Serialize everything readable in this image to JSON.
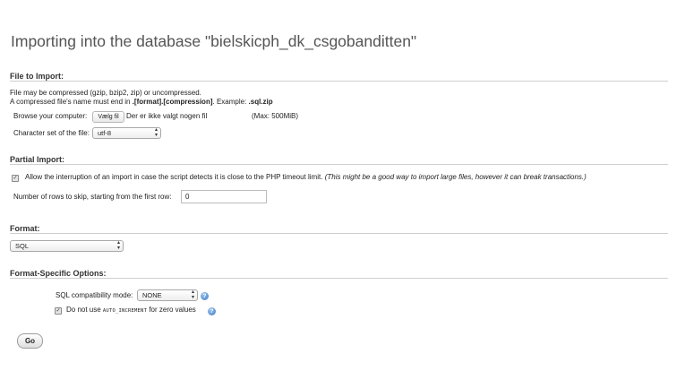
{
  "page": {
    "title": "Importing into the database \"bielskicph_dk_csgobanditten\""
  },
  "file_to_import": {
    "heading": "File to Import:",
    "compress_note": "File may be compressed (gzip, bzip2, zip) or uncompressed.",
    "name_note_prefix": "A compressed file's name must end in ",
    "name_note_format": ".[format].[compression]",
    "name_note_example_label": ". Example: ",
    "name_note_example": ".sql.zip",
    "browse_label": "Browse your computer:",
    "choose_file_button": "Vælg fil",
    "no_file_text": "Der er ikke valgt nogen fil",
    "max_size": "(Max: 500MiB)",
    "charset_label": "Character set of the file:",
    "charset_value": "utf-8"
  },
  "partial_import": {
    "heading": "Partial Import:",
    "allow_interrupt_checked": true,
    "allow_interrupt_label": "Allow the interruption of an import in case the script detects it is close to the PHP timeout limit.",
    "allow_interrupt_note": "(This might be a good way to import large files, however it can break transactions.)",
    "skip_rows_label": "Number of rows to skip, starting from the first row:",
    "skip_rows_value": "0"
  },
  "format": {
    "heading": "Format:",
    "value": "SQL"
  },
  "format_options": {
    "heading": "Format-Specific Options:",
    "compat_label": "SQL compatibility mode:",
    "compat_value": "NONE",
    "auto_inc_checked": true,
    "auto_inc_prefix": "Do not use ",
    "auto_inc_code": "AUTO_INCREMENT",
    "auto_inc_suffix": " for zero values"
  },
  "actions": {
    "go_label": "Go"
  },
  "icons": {
    "help": "help-icon",
    "select_arrows": "select-arrows-icon",
    "checkmark": "checkmark-icon"
  },
  "colors": {
    "title": "#555555",
    "rule": "#cfcfcf",
    "help_icon": "#3f7fc7"
  }
}
